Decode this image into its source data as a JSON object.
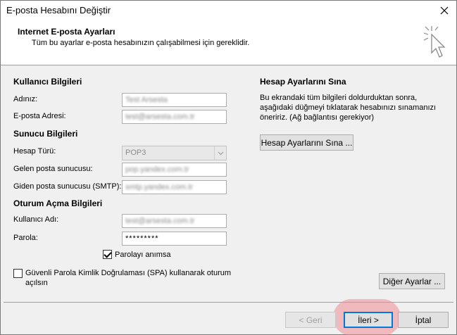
{
  "window": {
    "title": "E-posta Hesabını Değiştir"
  },
  "header": {
    "title": "Internet E-posta Ayarları",
    "subtitle": "Tüm bu ayarlar e-posta hesabınızın çalışabilmesi için gereklidir."
  },
  "user_info": {
    "section": "Kullanıcı Bilgileri",
    "name_label": "Adınız:",
    "name_value": "Test Arsesta",
    "email_label": "E-posta Adresi:",
    "email_value": "test@arsesta.com.tr"
  },
  "server_info": {
    "section": "Sunucu Bilgileri",
    "account_type_label": "Hesap Türü:",
    "account_type_value": "POP3",
    "incoming_label": "Gelen posta sunucusu:",
    "incoming_value": "pop.yandex.com.tr",
    "outgoing_label": "Giden posta sunucusu (SMTP):",
    "outgoing_value": "smtp.yandex.com.tr"
  },
  "logon_info": {
    "section": "Oturum Açma Bilgileri",
    "username_label": "Kullanıcı Adı:",
    "username_value": "test@arsesta.com.tr",
    "password_label": "Parola:",
    "password_value": "*********",
    "remember_label": "Parolayı anımsa",
    "remember_checked": true,
    "spa_label_line1": "Güvenli Parola Kimlik Doğrulaması (SPA) kullanarak oturum",
    "spa_label_line2": "açılsın",
    "spa_checked": false
  },
  "test_settings": {
    "section": "Hesap Ayarlarını Sına",
    "description": "Bu ekrandaki tüm bilgileri doldurduktan sonra, aşağıdaki düğmeyi tıklatarak hesabınızı sınamanızı öneririz. (Ağ bağlantısı gerekiyor)",
    "button_label": "Hesap Ayarlarını Sına ..."
  },
  "buttons": {
    "more_settings": "Diğer Ayarlar ...",
    "back": "< Geri",
    "next": "İleri >",
    "cancel": "İptal"
  },
  "colors": {
    "accent": "#0078d7",
    "highlight": "#f08c96"
  }
}
